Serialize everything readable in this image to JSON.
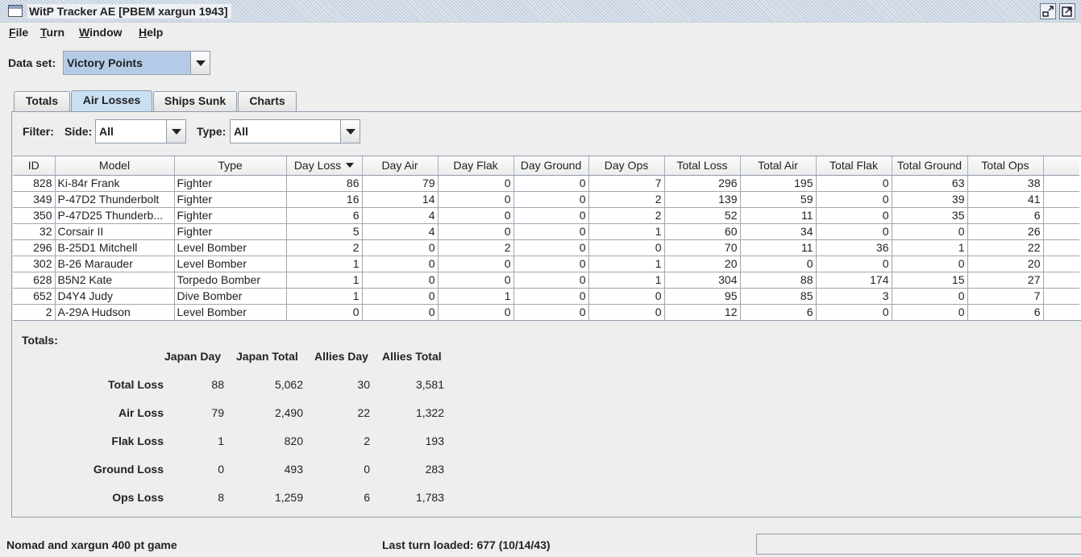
{
  "window": {
    "title": "WitP Tracker AE [PBEM xargun 1943]"
  },
  "menu": [
    {
      "mnemonic": "F",
      "rest": "ile"
    },
    {
      "mnemonic": "T",
      "rest": "urn"
    },
    {
      "mnemonic": "W",
      "rest": "indow"
    },
    {
      "mnemonic": "H",
      "rest": "elp"
    }
  ],
  "dataset": {
    "label": "Data set:",
    "value": "Victory Points"
  },
  "tabs": [
    {
      "label": "Totals",
      "active": false
    },
    {
      "label": "Air Losses",
      "active": true
    },
    {
      "label": "Ships Sunk",
      "active": false
    },
    {
      "label": "Charts",
      "active": false
    }
  ],
  "filters": {
    "filter_label": "Filter:",
    "side_label": "Side:",
    "side_value": "All",
    "type_label": "Type:",
    "type_value": "All"
  },
  "table": {
    "columns": [
      "ID",
      "Model",
      "Type",
      "Day Loss",
      "Day Air",
      "Day Flak",
      "Day Ground",
      "Day Ops",
      "Total Loss",
      "Total Air",
      "Total Flak",
      "Total Ground",
      "Total Ops"
    ],
    "sorted_column": "Day Loss",
    "rows": [
      [
        "828",
        "Ki-84r Frank",
        "Fighter",
        "86",
        "79",
        "0",
        "0",
        "7",
        "296",
        "195",
        "0",
        "63",
        "38"
      ],
      [
        "349",
        "P-47D2 Thunderbolt",
        "Fighter",
        "16",
        "14",
        "0",
        "0",
        "2",
        "139",
        "59",
        "0",
        "39",
        "41"
      ],
      [
        "350",
        "P-47D25 Thunderb...",
        "Fighter",
        "6",
        "4",
        "0",
        "0",
        "2",
        "52",
        "11",
        "0",
        "35",
        "6"
      ],
      [
        "32",
        "Corsair II",
        "Fighter",
        "5",
        "4",
        "0",
        "0",
        "1",
        "60",
        "34",
        "0",
        "0",
        "26"
      ],
      [
        "296",
        "B-25D1 Mitchell",
        "Level Bomber",
        "2",
        "0",
        "2",
        "0",
        "0",
        "70",
        "11",
        "36",
        "1",
        "22"
      ],
      [
        "302",
        "B-26 Marauder",
        "Level Bomber",
        "1",
        "0",
        "0",
        "0",
        "1",
        "20",
        "0",
        "0",
        "0",
        "20"
      ],
      [
        "628",
        "B5N2 Kate",
        "Torpedo Bomber",
        "1",
        "0",
        "0",
        "0",
        "1",
        "304",
        "88",
        "174",
        "15",
        "27"
      ],
      [
        "652",
        "D4Y4 Judy",
        "Dive Bomber",
        "1",
        "0",
        "1",
        "0",
        "0",
        "95",
        "85",
        "3",
        "0",
        "7"
      ],
      [
        "2",
        "A-29A Hudson",
        "Level Bomber",
        "0",
        "0",
        "0",
        "0",
        "0",
        "12",
        "6",
        "0",
        "0",
        "6"
      ]
    ]
  },
  "totals": {
    "label": "Totals:",
    "columns": [
      "Japan Day",
      "Japan Total",
      "Allies Day",
      "Allies Total"
    ],
    "rows": [
      {
        "label": "Total Loss",
        "values": [
          "88",
          "5,062",
          "30",
          "3,581"
        ]
      },
      {
        "label": "Air Loss",
        "values": [
          "79",
          "2,490",
          "22",
          "1,322"
        ]
      },
      {
        "label": "Flak Loss",
        "values": [
          "1",
          "820",
          "2",
          "193"
        ]
      },
      {
        "label": "Ground Loss",
        "values": [
          "0",
          "493",
          "0",
          "283"
        ]
      },
      {
        "label": "Ops Loss",
        "values": [
          "8",
          "1,259",
          "6",
          "1,783"
        ]
      }
    ]
  },
  "status": {
    "game": "Nomad and xargun 400 pt game",
    "last_turn": "Last turn loaded: 677 (10/14/43)"
  }
}
